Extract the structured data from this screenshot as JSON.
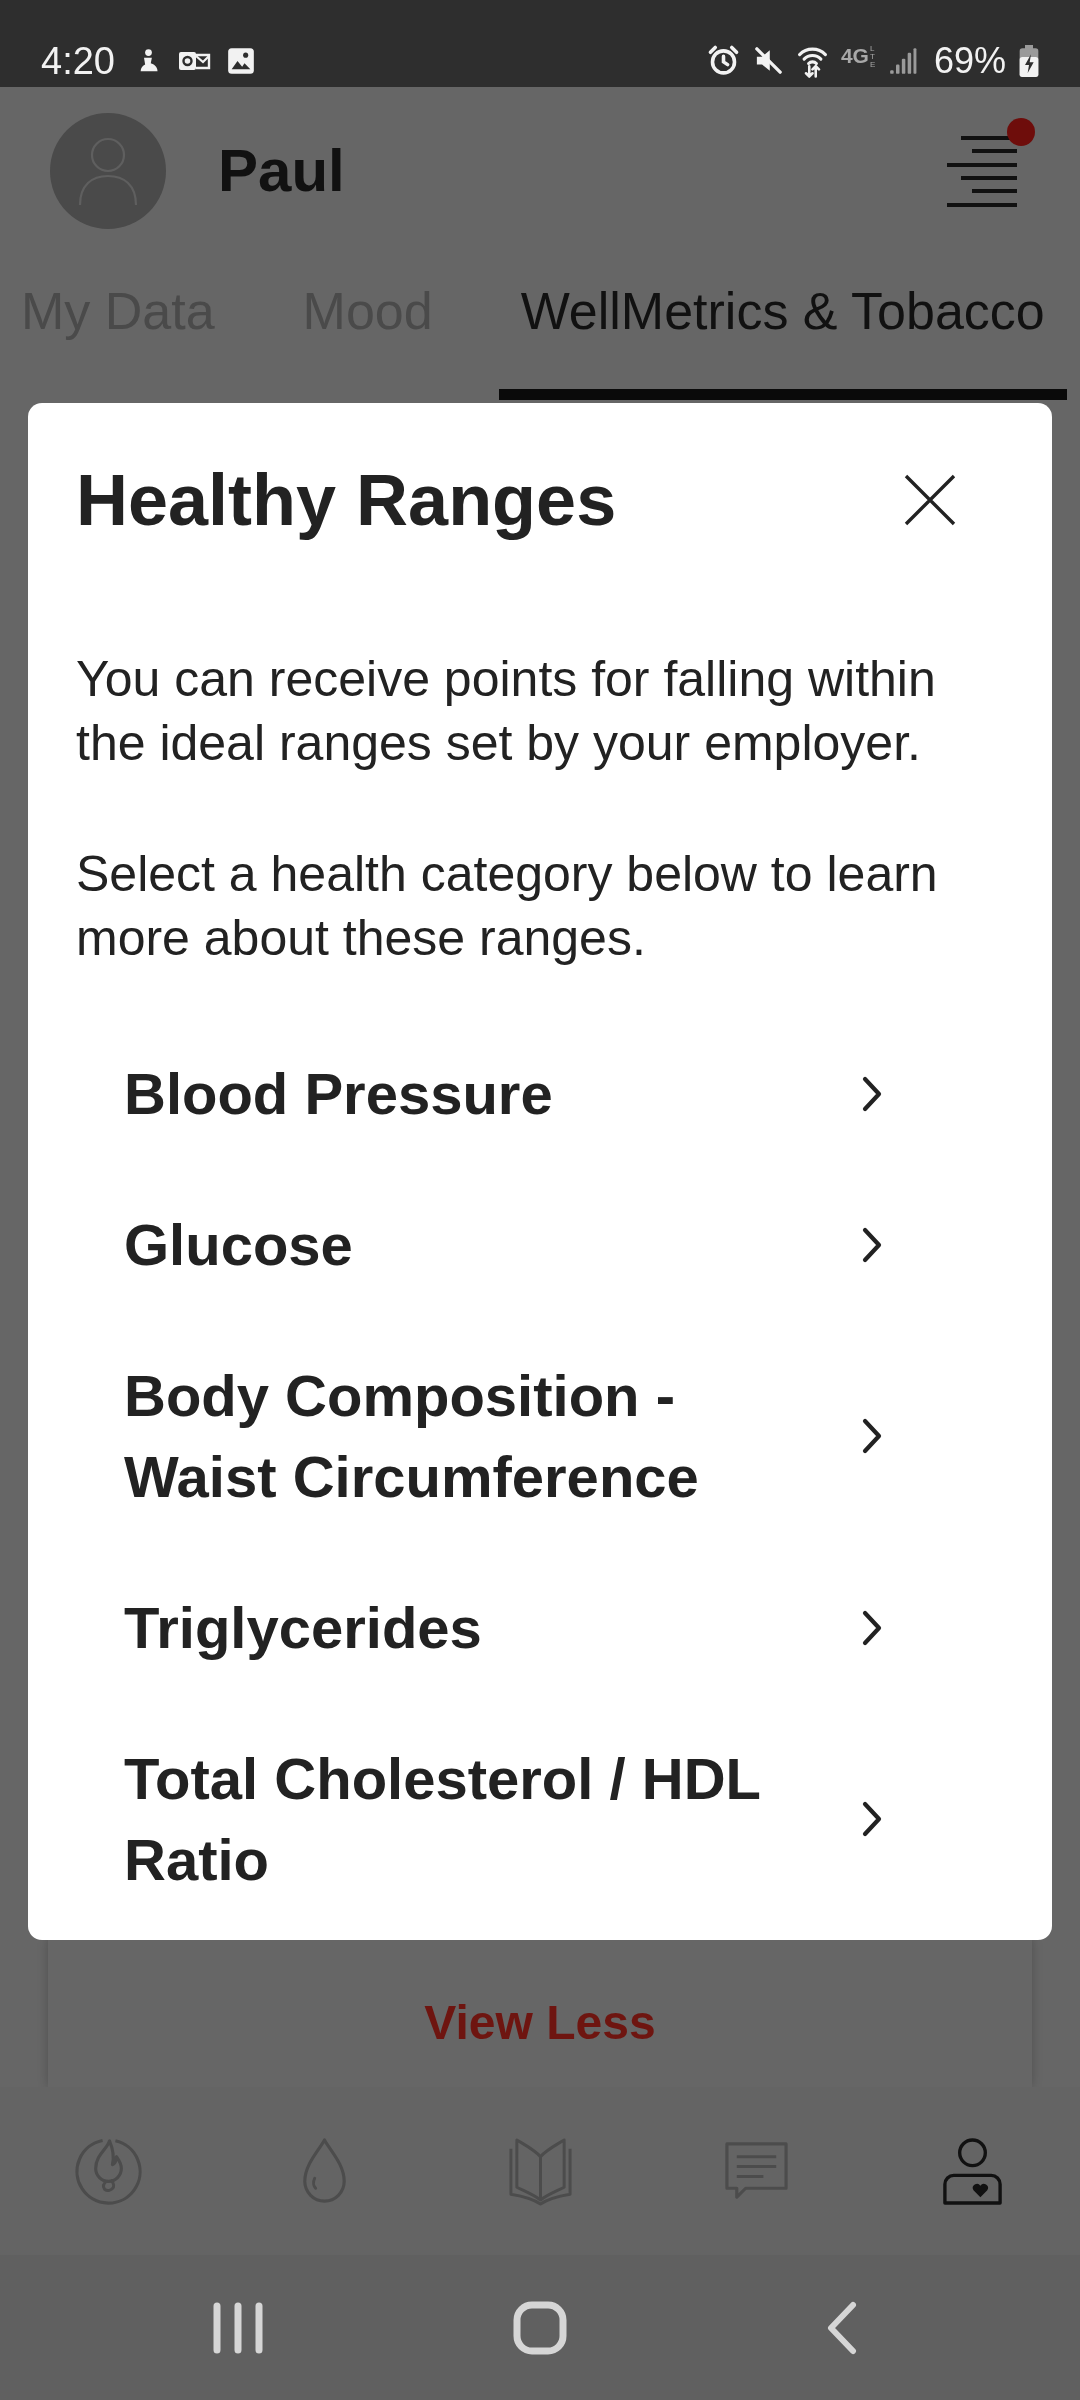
{
  "status_bar": {
    "time": "4:20",
    "network": "4G",
    "network_sub": "LTE",
    "battery": "69%"
  },
  "header": {
    "user_name": "Paul",
    "menu_notification": true
  },
  "tabs": [
    {
      "label": "My Data",
      "selected": false
    },
    {
      "label": "Mood",
      "selected": false
    },
    {
      "label": "WellMetrics & Tobacco",
      "selected": true
    }
  ],
  "modal": {
    "title": "Healthy Ranges",
    "paragraphs": [
      "You can receive points for falling within the ideal ranges set by your employer.",
      "Select a health category below to learn more about these ranges."
    ],
    "categories": [
      "Blood Pressure",
      "Glucose",
      "Body Composition - Waist Circumference",
      "Triglycerides",
      "Total Cholesterol / HDL Ratio"
    ]
  },
  "card": {
    "link": "View Less"
  },
  "bottom_nav": [
    {
      "selected": false
    },
    {
      "selected": false
    },
    {
      "selected": false
    },
    {
      "selected": false
    },
    {
      "selected": true
    }
  ]
}
